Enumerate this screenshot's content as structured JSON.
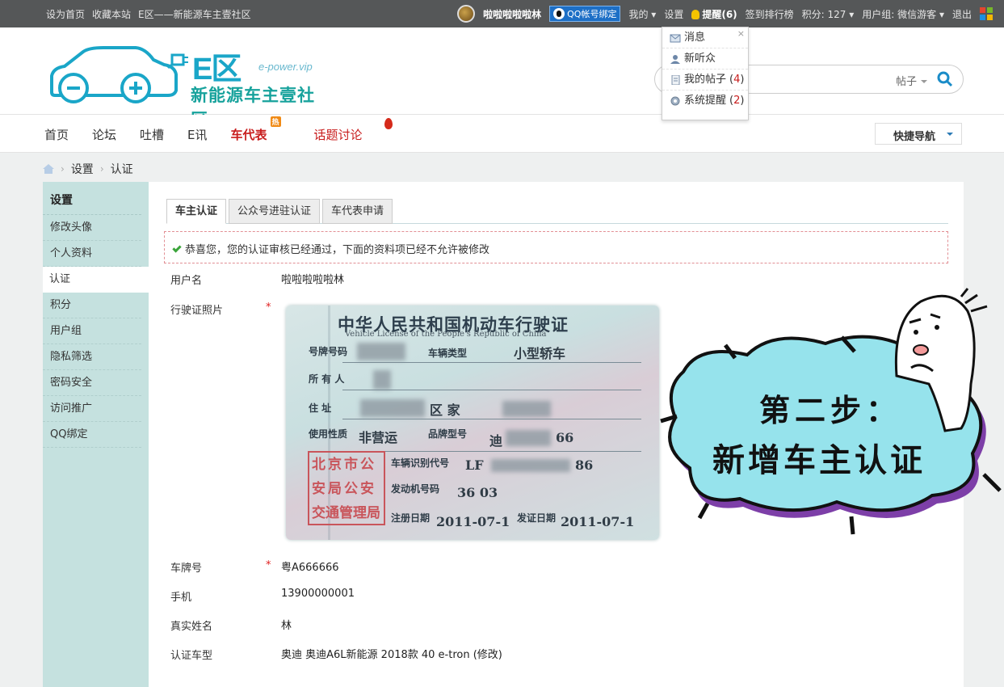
{
  "topbar": {
    "left_links": [
      "设为首页",
      "收藏本站",
      "E区——新能源车主壹社区"
    ],
    "username": "啦啦啦啦啦林",
    "qq_bind": "QQ帐号绑定",
    "mine": "我的",
    "settings": "设置",
    "reminders": "提醒(6)",
    "checkin": "签到排行榜",
    "points": "积分: 127",
    "usergroup": "用户组: 微信游客",
    "logout": "退出"
  },
  "logo": {
    "big": "E区",
    "url": "e-power.vip",
    "subtitle": "新能源车主壹社区"
  },
  "search": {
    "type": "帖子"
  },
  "nav": {
    "items": [
      "首页",
      "论坛",
      "吐槽",
      "E讯",
      "车代表",
      "话题讨论"
    ],
    "hot_badge": "热",
    "quick_nav": "快捷导航"
  },
  "breadcrumb": {
    "items": [
      "设置",
      "认证"
    ]
  },
  "sidebar": {
    "title": "设置",
    "items": [
      "修改头像",
      "个人资料",
      "认证",
      "积分",
      "用户组",
      "隐私筛选",
      "密码安全",
      "访问推广",
      "QQ绑定"
    ]
  },
  "tabs": [
    "车主认证",
    "公众号进驻认证",
    "车代表申请"
  ],
  "notice": "恭喜您，您的认证审核已经通过，下面的资料项已经不允许被修改",
  "form": {
    "username_label": "用户名",
    "username_value": "啦啦啦啦啦林",
    "license_label": "行驶证照片",
    "plate_label": "车牌号",
    "plate_value": "粤A666666",
    "phone_label": "手机",
    "phone_value": "13900000001",
    "realname_label": "真实姓名",
    "realname_value": "林",
    "model_label": "认证车型",
    "model_value": "奥迪 奥迪A6L新能源 2018款 40 e-tron (修改)",
    "required_mark": "*"
  },
  "license_image": {
    "title": "中华人民共和国机动车行驶证",
    "title_en": "Vehicle License of the People's Republic of China",
    "plate_no": "号牌号码",
    "vehicle_type_label": "车辆类型",
    "vehicle_type": "小型轿车",
    "owner": "所 有 人",
    "address": "住 址",
    "address_part": "区 家",
    "use_character": "使用性质",
    "use_value": "非营运",
    "model_label": "品牌型号",
    "model_value": "迪",
    "model_suffix": "66",
    "vin_label": "车辆识别代号",
    "vin_value": "LF",
    "vin_suffix": "86",
    "engine_label": "发动机号码",
    "engine_value": "36 03",
    "reg_label": "注册日期",
    "reg_value": "2011-07-1",
    "issue_label": "发证日期",
    "issue_value": "2011-07-1",
    "stamp": [
      "北京市公",
      "安局公安",
      "交通管理局"
    ]
  },
  "popup": {
    "items": [
      {
        "label": "消息",
        "count": ""
      },
      {
        "label": "新听众",
        "count": ""
      },
      {
        "label": "我的帖子",
        "count": "4"
      },
      {
        "label": "系统提醒",
        "count": "2"
      }
    ],
    "close": "×"
  },
  "cartoon": {
    "line1": "第二步：",
    "line2": "新增车主认证"
  }
}
